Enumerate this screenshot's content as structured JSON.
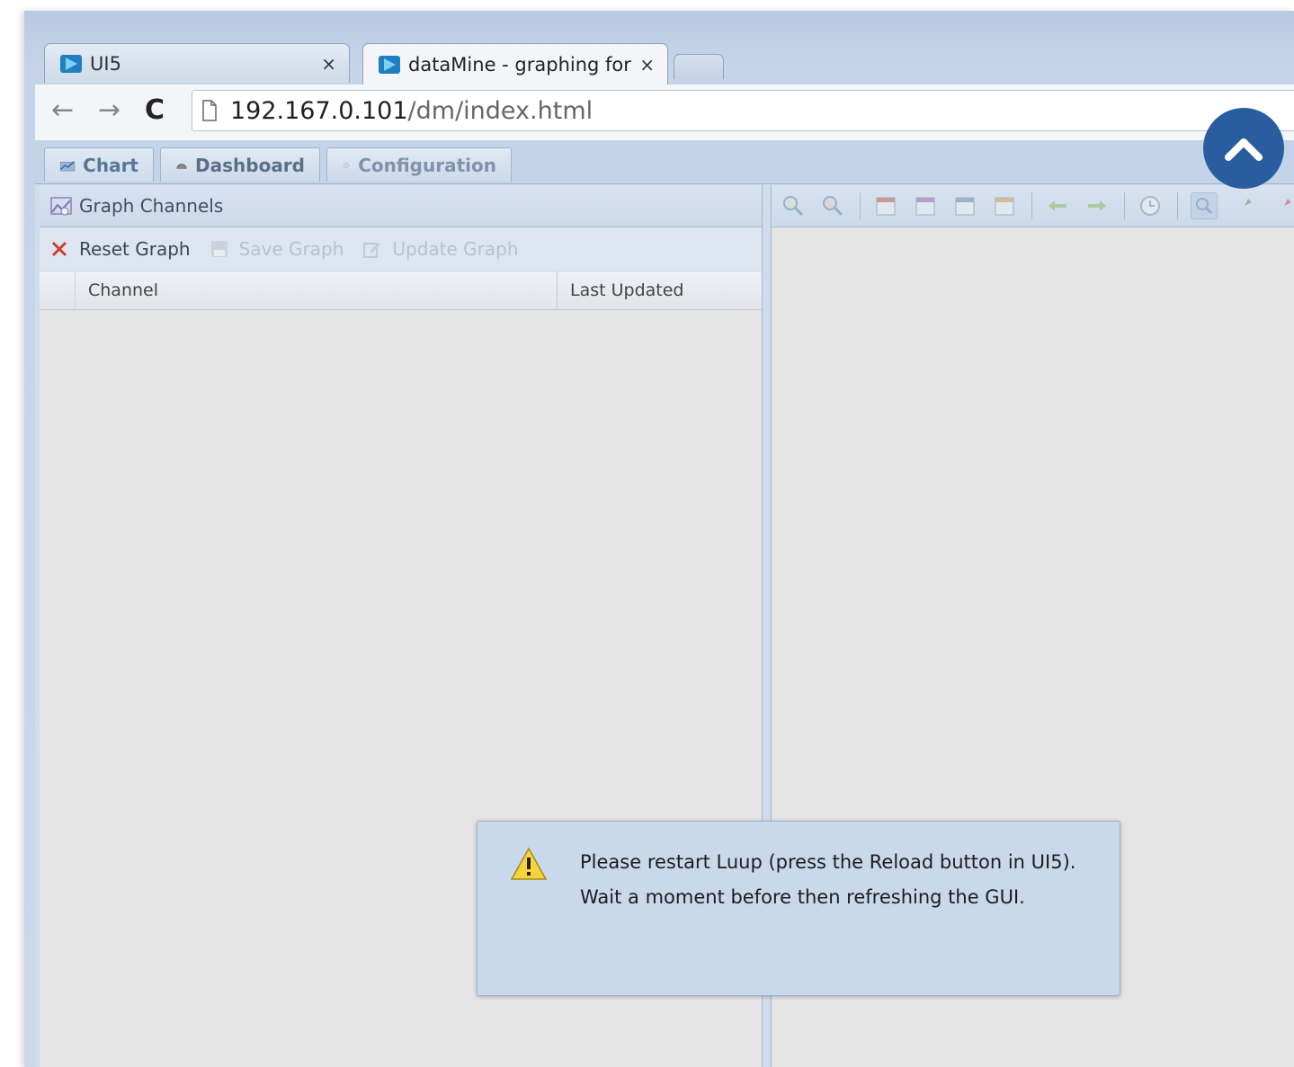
{
  "browser": {
    "tabs": [
      {
        "title": "UI5",
        "active": false
      },
      {
        "title": "dataMine - graphing for V",
        "active": true
      }
    ],
    "close_glyph": "×",
    "url_host": "192.167.0.101",
    "url_path": "/dm/index.html"
  },
  "app": {
    "tabs": [
      {
        "label": "Chart",
        "icon": "chart-icon"
      },
      {
        "label": "Dashboard",
        "icon": "dashboard-icon"
      },
      {
        "label": "Configuration",
        "icon": "gear-icon"
      }
    ],
    "left_panel": {
      "title": "Graph Channels",
      "toolbar": {
        "reset": "Reset Graph",
        "save": "Save Graph",
        "update": "Update Graph"
      },
      "columns": {
        "channel": "Channel",
        "last_updated": "Last Updated"
      }
    },
    "chart_toolbar_icons": [
      "zoom-in-icon",
      "zoom-out-icon",
      "calendar-day-icon",
      "calendar-week-icon",
      "calendar-month-icon",
      "calendar-year-icon",
      "arrow-left-icon",
      "arrow-right-icon",
      "clock-icon",
      "magnifier-icon",
      "pin-green-icon",
      "pin-red-icon"
    ]
  },
  "dialog": {
    "message": "Please restart Luup (press the Reload button in UI5). Wait a moment before then refreshing the GUI."
  },
  "colors": {
    "accent": "#2a5d9f",
    "frame": "#c5d4e8",
    "panel_bg": "#e4e4e4",
    "dialog_bg": "#c9d8eb"
  }
}
